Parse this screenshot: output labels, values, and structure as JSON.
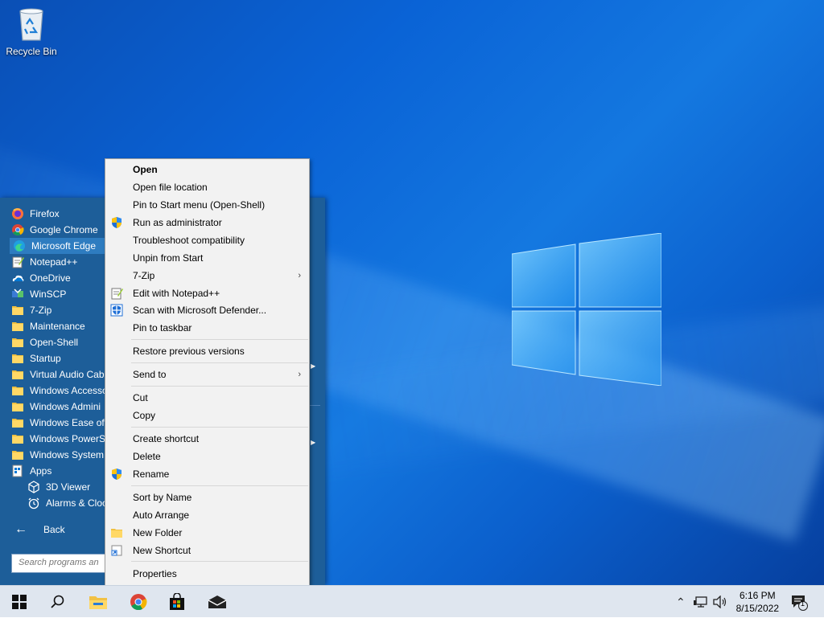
{
  "desktop": {
    "recycle_bin_label": "Recycle Bin"
  },
  "start_menu": {
    "programs": [
      {
        "label": "Firefox",
        "icon": "firefox-icon"
      },
      {
        "label": "Google Chrome",
        "icon": "chrome-icon"
      },
      {
        "label": "Microsoft Edge",
        "icon": "edge-icon",
        "selected": true
      },
      {
        "label": "Notepad++",
        "icon": "notepadpp-icon"
      },
      {
        "label": "OneDrive",
        "icon": "onedrive-icon"
      },
      {
        "label": "WinSCP",
        "icon": "winscp-icon"
      },
      {
        "label": "7-Zip",
        "icon": "folder-icon"
      },
      {
        "label": "Maintenance",
        "icon": "folder-icon"
      },
      {
        "label": "Open-Shell",
        "icon": "folder-icon"
      },
      {
        "label": "Startup",
        "icon": "folder-icon"
      },
      {
        "label": "Virtual Audio Cab",
        "icon": "folder-icon"
      },
      {
        "label": "Windows Accesso",
        "icon": "folder-icon"
      },
      {
        "label": "Windows Admini",
        "icon": "folder-icon"
      },
      {
        "label": "Windows Ease of",
        "icon": "folder-icon"
      },
      {
        "label": "Windows PowerS",
        "icon": "folder-icon"
      },
      {
        "label": "Windows System",
        "icon": "folder-icon"
      },
      {
        "label": "Apps",
        "icon": "apps-icon"
      },
      {
        "label": "3D Viewer",
        "icon": "3d-viewer-icon"
      },
      {
        "label": "Alarms & Cloc",
        "icon": "alarm-icon"
      }
    ],
    "back_label": "Back",
    "search_placeholder": "Search programs an"
  },
  "context_menu": {
    "items": [
      {
        "label": "Open",
        "bold": true
      },
      {
        "label": "Open file location"
      },
      {
        "label": "Pin to Start menu (Open-Shell)"
      },
      {
        "label": "Run as administrator",
        "icon": "uac-shield-icon"
      },
      {
        "label": "Troubleshoot compatibility"
      },
      {
        "label": "Unpin from Start"
      },
      {
        "label": "7-Zip",
        "submenu": true
      },
      {
        "label": "Edit with Notepad++",
        "icon": "notepadpp-icon"
      },
      {
        "label": "Scan with Microsoft Defender...",
        "icon": "defender-icon"
      },
      {
        "label": "Pin to taskbar"
      },
      {
        "label": "Restore previous versions"
      },
      {
        "label": "Send to",
        "submenu": true
      },
      {
        "label": "Cut"
      },
      {
        "label": "Copy"
      },
      {
        "label": "Create shortcut"
      },
      {
        "label": "Delete"
      },
      {
        "label": "Rename",
        "icon": "uac-shield-icon"
      },
      {
        "label": "Sort by Name"
      },
      {
        "label": "Auto Arrange"
      },
      {
        "label": "New Folder",
        "icon": "folder-icon"
      },
      {
        "label": "New Shortcut",
        "icon": "shortcut-icon"
      },
      {
        "label": "Properties"
      }
    ],
    "submenu_arrow": "›"
  },
  "taskbar": {
    "time": "6:16 PM",
    "date": "8/15/2022",
    "notification_count": "1"
  }
}
